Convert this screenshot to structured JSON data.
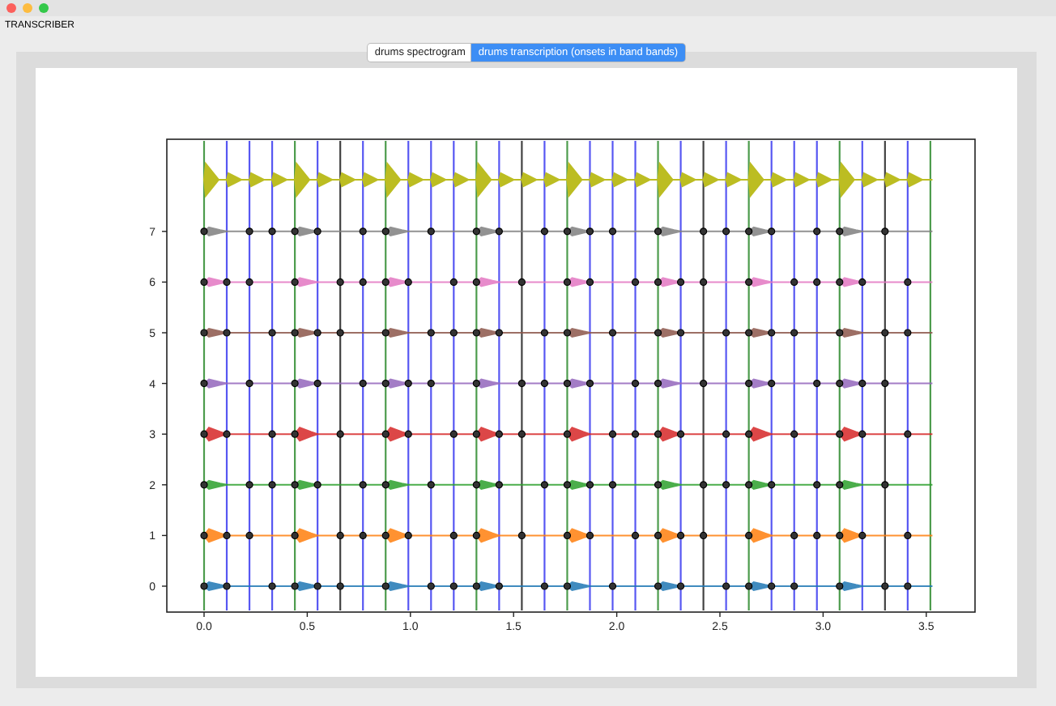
{
  "window": {
    "title": "TRANSCRIBER"
  },
  "tabs": [
    {
      "label": "drums spectrogram",
      "selected": false
    },
    {
      "label": "drums transcription (onsets in band bands)",
      "selected": true
    }
  ],
  "plot": {
    "yticks": [
      "7",
      "6",
      "5",
      "4",
      "3",
      "2",
      "1",
      "0"
    ],
    "xticks": [
      "0.0",
      "0.5",
      "1.0",
      "1.5",
      "2.0",
      "2.5",
      "3.0",
      "3.5"
    ]
  }
}
